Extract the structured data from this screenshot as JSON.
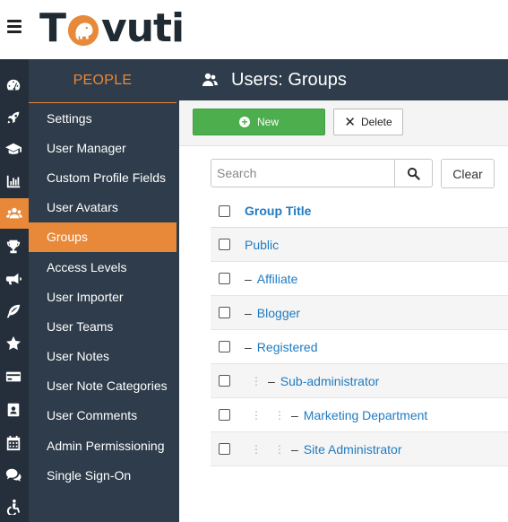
{
  "header": {
    "logo_t": "T",
    "logo_rest": "vuti"
  },
  "submenu": {
    "title": "PEOPLE",
    "items": [
      {
        "label": "Settings"
      },
      {
        "label": "User Manager"
      },
      {
        "label": "Custom Profile Fields"
      },
      {
        "label": "User Avatars"
      },
      {
        "label": "Groups",
        "active": true
      },
      {
        "label": "Access Levels"
      },
      {
        "label": "User Importer"
      },
      {
        "label": "User Teams"
      },
      {
        "label": "User Notes"
      },
      {
        "label": "User Note Categories"
      },
      {
        "label": "User Comments"
      },
      {
        "label": "Admin Permissioning"
      },
      {
        "label": "Single Sign-On"
      }
    ]
  },
  "rail_icons": [
    "dashboard-icon",
    "rocket-icon",
    "graduation-cap-icon",
    "bar-chart-icon",
    "users-icon",
    "trophy-icon",
    "megaphone-icon",
    "feather-icon",
    "star-icon",
    "credit-card-icon",
    "id-badge-icon",
    "calendar-icon",
    "chat-icon",
    "accessibility-icon"
  ],
  "main": {
    "title": "Users: Groups"
  },
  "toolbar": {
    "new_label": "New",
    "delete_label": "Delete"
  },
  "search": {
    "placeholder": "Search",
    "clear_label": "Clear"
  },
  "table": {
    "header": "Group Title",
    "rows": [
      {
        "title": "Public",
        "level": 0
      },
      {
        "title": "Affiliate",
        "level": 1
      },
      {
        "title": "Blogger",
        "level": 1
      },
      {
        "title": "Registered",
        "level": 1
      },
      {
        "title": "Sub-administrator",
        "level": 2
      },
      {
        "title": "Marketing Department",
        "level": 3
      },
      {
        "title": "Site Administrator",
        "level": 3
      }
    ]
  },
  "colors": {
    "accent": "#e8893a",
    "sidebar": "#2e3c4b",
    "rail": "#252f3b",
    "link": "#1f7bc1",
    "new_button": "#4cae4c"
  }
}
